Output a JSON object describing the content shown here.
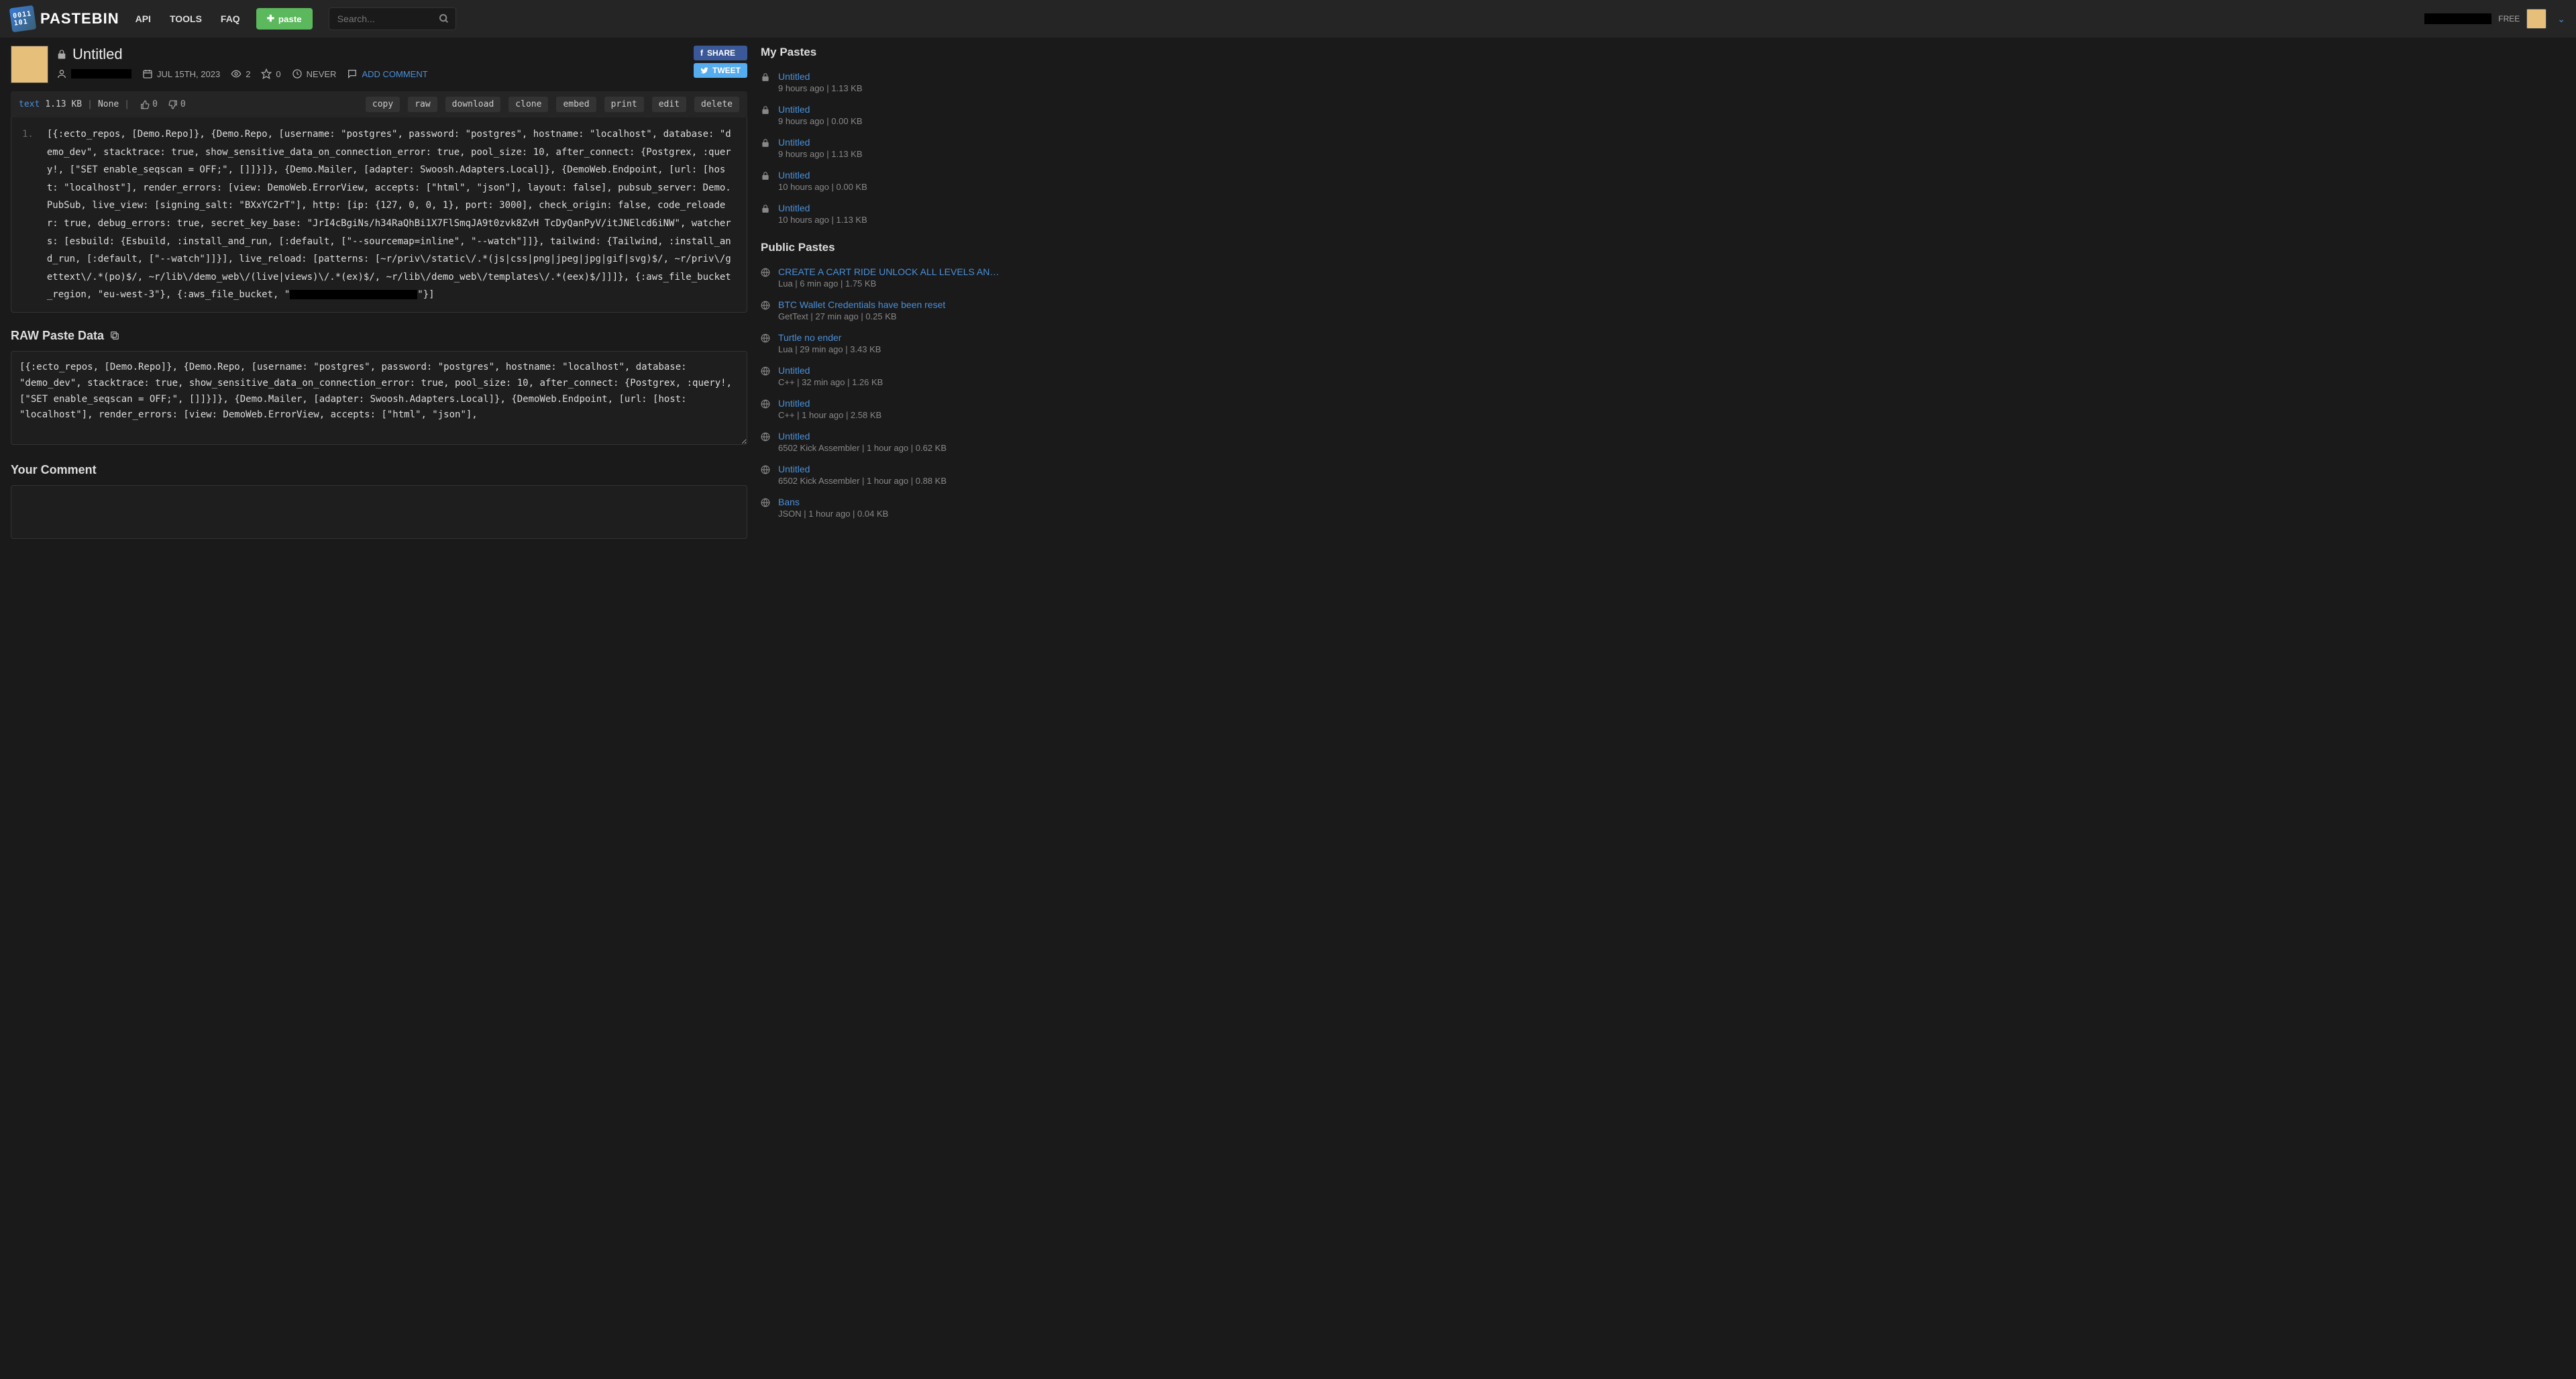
{
  "header": {
    "brand": "PASTEBIN",
    "nav": {
      "api": "API",
      "tools": "TOOLS",
      "faq": "FAQ"
    },
    "paste_btn": "paste",
    "search_placeholder": "Search...",
    "account_label": "FREE"
  },
  "paste": {
    "title": "Untitled",
    "date": "JUL 15TH, 2023",
    "views": "2",
    "stars": "0",
    "expiry": "NEVER",
    "add_comment": "ADD COMMENT",
    "share": "SHARE",
    "tweet": "TWEET"
  },
  "toolbar": {
    "lang": "text",
    "size": "1.13 KB",
    "category": "None",
    "likes": "0",
    "dislikes": "0",
    "actions": {
      "copy": "copy",
      "raw": "raw",
      "download": "download",
      "clone": "clone",
      "embed": "embed",
      "print": "print",
      "edit": "edit",
      "delete": "delete"
    }
  },
  "code": {
    "line1": "[{:ecto_repos, [Demo.Repo]}, {Demo.Repo, [username: \"postgres\", password: \"postgres\", hostname: \"localhost\", database: \"demo_dev\", stacktrace: true, show_sensitive_data_on_connection_error: true, pool_size: 10, after_connect: {Postgrex, :query!, [\"SET enable_seqscan = OFF;\", []]}]}, {Demo.Mailer, [adapter: Swoosh.Adapters.Local]}, {DemoWeb.Endpoint, [url: [host: \"localhost\"], render_errors: [view: DemoWeb.ErrorView, accepts: [\"html\", \"json\"], layout: false], pubsub_server: Demo.PubSub, live_view: [signing_salt: \"BXxYC2rT\"], http: [ip: {127, 0, 0, 1}, port: 3000], check_origin: false, code_reloader: true, debug_errors: true, secret_key_base: \"JrI4cBgiNs/h34RaQhBi1X7FlSmqJA9t0zvk8ZvH TcDyQanPyV/itJNElcd6iNW\", watchers: [esbuild: {Esbuild, :install_and_run, [:default, [\"--sourcemap=inline\", \"--watch\"]]}, tailwind: {Tailwind, :install_and_run, [:default, [\"--watch\"]]}], live_reload: [patterns: [~r/priv\\/static\\/.*(js|css|png|jpeg|jpg|gif|svg)$/, ~r/priv\\/gettext\\/.*(po)$/, ~r/lib\\/demo_web\\/(live|views)\\/.*(ex)$/, ~r/lib\\/demo_web\\/templates\\/.*(eex)$/]]]}, {:aws_file_bucket_region, \"eu-west-3\"}, {:aws_file_bucket, \"",
    "line1_suffix": "\"}]"
  },
  "raw": {
    "title": "RAW Paste Data",
    "content": "[{:ecto_repos, [Demo.Repo]}, {Demo.Repo, [username: \"postgres\", password: \"postgres\", hostname: \"localhost\", database: \"demo_dev\", stacktrace: true, show_sensitive_data_on_connection_error: true, pool_size: 10, after_connect: {Postgrex, :query!, [\"SET enable_seqscan = OFF;\", []]}]}, {Demo.Mailer, [adapter: Swoosh.Adapters.Local]}, {DemoWeb.Endpoint, [url: [host: \"localhost\"], render_errors: [view: DemoWeb.ErrorView, accepts: [\"html\", \"json\"],"
  },
  "comment": {
    "title": "Your Comment"
  },
  "sidebar": {
    "my_pastes_title": "My Pastes",
    "my_pastes": [
      {
        "title": "Untitled",
        "meta": "9 hours ago | 1.13 KB"
      },
      {
        "title": "Untitled",
        "meta": "9 hours ago | 0.00 KB"
      },
      {
        "title": "Untitled",
        "meta": "9 hours ago | 1.13 KB"
      },
      {
        "title": "Untitled",
        "meta": "10 hours ago | 0.00 KB"
      },
      {
        "title": "Untitled",
        "meta": "10 hours ago | 1.13 KB"
      }
    ],
    "public_pastes_title": "Public Pastes",
    "public_pastes": [
      {
        "title": "CREATE A CART RIDE UNLOCK ALL LEVELS AND GET...",
        "meta": "Lua | 6 min ago | 1.75 KB"
      },
      {
        "title": "BTC Wallet Credentials have been reset",
        "meta": "GetText | 27 min ago | 0.25 KB"
      },
      {
        "title": "Turtle no ender",
        "meta": "Lua | 29 min ago | 3.43 KB"
      },
      {
        "title": "Untitled",
        "meta": "C++ | 32 min ago | 1.26 KB"
      },
      {
        "title": "Untitled",
        "meta": "C++ | 1 hour ago | 2.58 KB"
      },
      {
        "title": "Untitled",
        "meta": "6502 Kick Assembler | 1 hour ago | 0.62 KB"
      },
      {
        "title": "Untitled",
        "meta": "6502 Kick Assembler | 1 hour ago | 0.88 KB"
      },
      {
        "title": "Bans",
        "meta": "JSON | 1 hour ago | 0.04 KB"
      }
    ]
  }
}
